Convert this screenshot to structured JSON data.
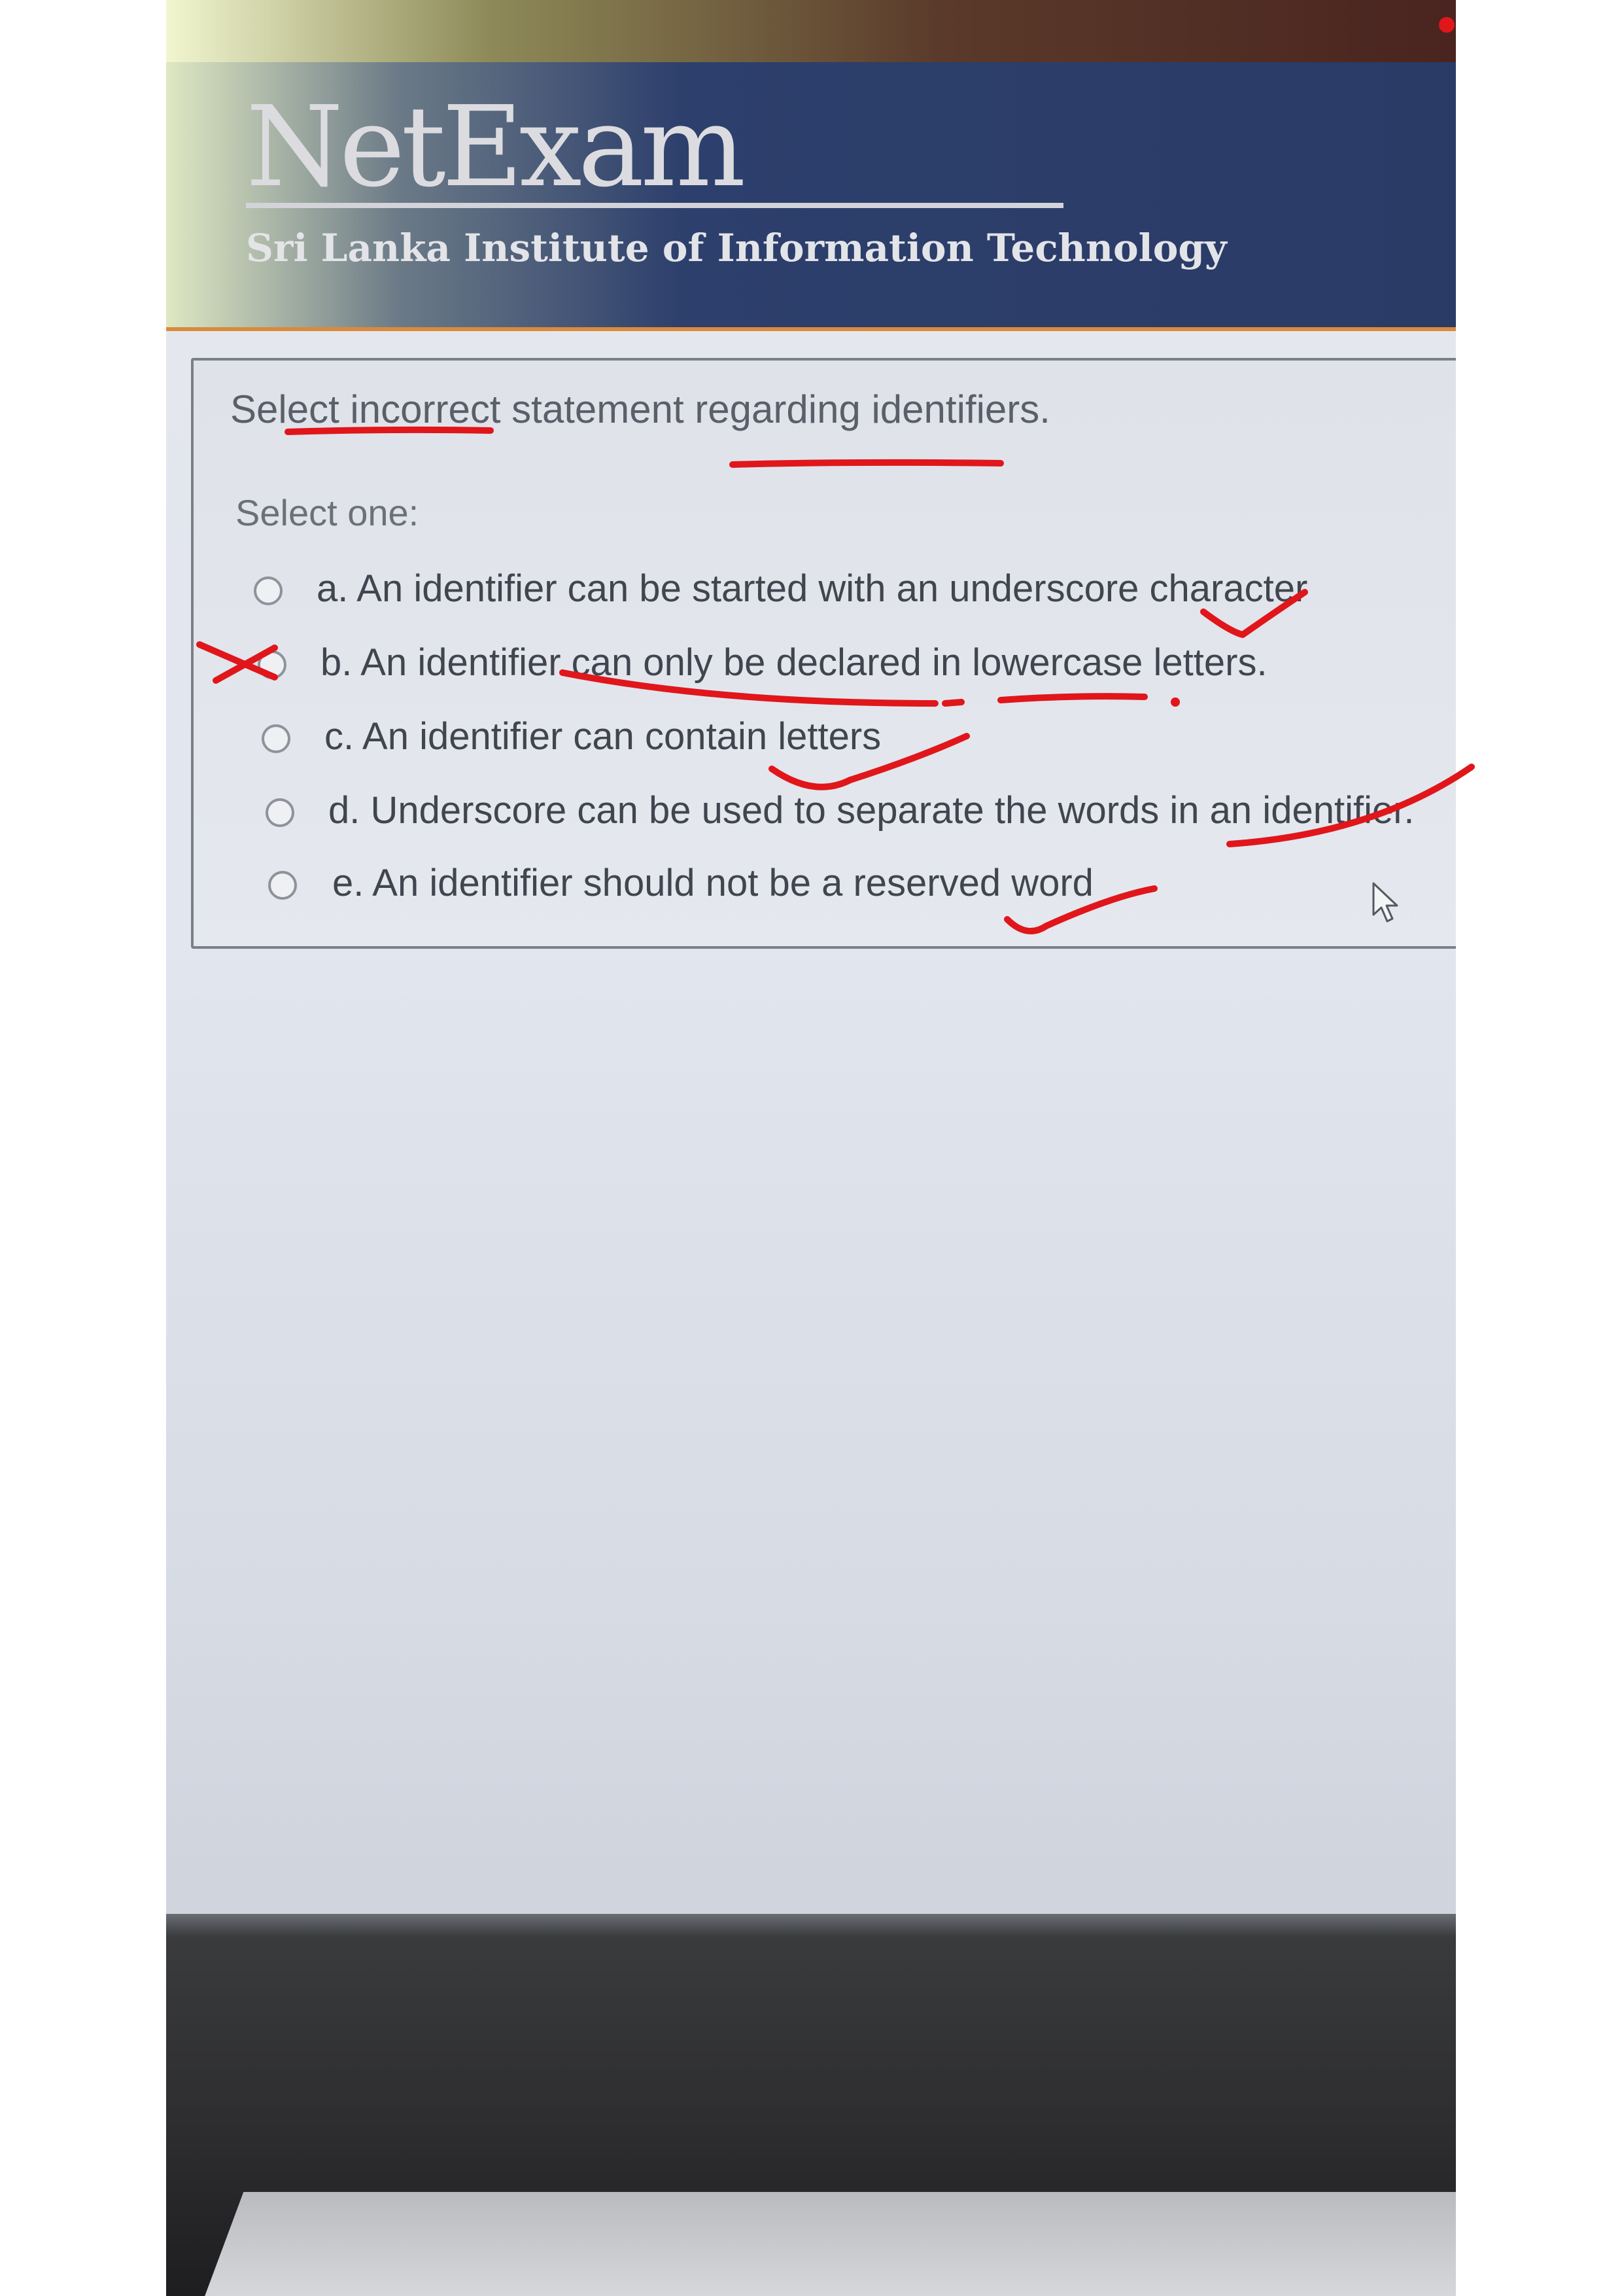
{
  "app": {
    "logo_title": "NetExam",
    "logo_subtitle": "Sri Lanka Institute of Information Technology"
  },
  "question": {
    "text": "Select incorrect statement regarding identifiers.",
    "prompt": "Select one:",
    "options": [
      {
        "label": "a. An identifier can be started with an underscore character"
      },
      {
        "label": "b. An identifier can only be declared in lowercase letters."
      },
      {
        "label": "c. An identifier can contain letters"
      },
      {
        "label": "d. Underscore can be used to separate the words in an identifier."
      },
      {
        "label": "e. An identifier should not be a reserved word"
      }
    ]
  },
  "icons": {
    "cursor": "mouse-pointer-icon",
    "radio": "radio-button-icon"
  },
  "colors": {
    "header_blue": "#2a3b66",
    "header_accent": "#d98b3a",
    "annotation_red": "#e0161b"
  }
}
